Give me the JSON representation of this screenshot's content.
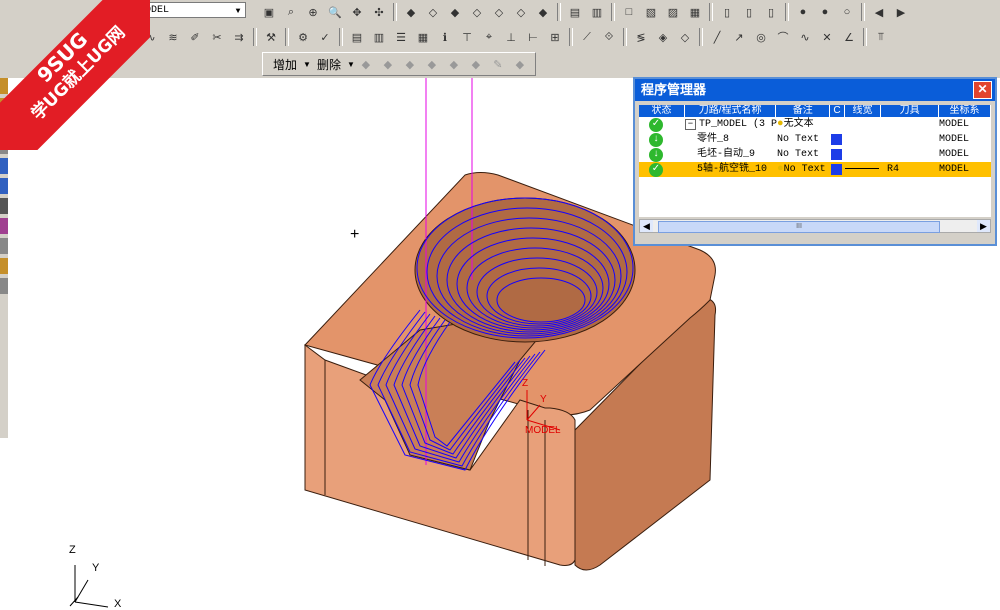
{
  "watermark": {
    "line1": "9SUG",
    "line2": "学UG就上UG网"
  },
  "toolbar": {
    "model_combo": {
      "value": "MODEL"
    },
    "add_label": "增加",
    "delete_label": "删除"
  },
  "navigator": {
    "title": "程序管理器",
    "close_label": "✕",
    "columns": [
      "状态",
      "刀路/程式名称",
      "备注",
      "C",
      "线宽",
      "刀具",
      "坐标系"
    ],
    "rows": [
      {
        "name": "TP_MODEL (3 P",
        "note": "无文本",
        "tool": "",
        "coord": "MODEL"
      },
      {
        "name": "零件_8",
        "note": "No Text",
        "tool": "",
        "coord": "MODEL"
      },
      {
        "name": "毛坯-自动_9",
        "note": "No Text",
        "tool": "",
        "coord": "MODEL"
      },
      {
        "name": "5轴-航空铣_10",
        "note": "No Text",
        "tool": "R4",
        "coord": "MODEL"
      }
    ],
    "scroll_grip": "III"
  },
  "viewport": {
    "model_csys_labels": {
      "z": "Z",
      "y": "Y",
      "name": "MODEL"
    },
    "triad_labels": {
      "z": "Z",
      "y": "Y",
      "x": "X"
    },
    "colors": {
      "part": "#d98e63",
      "toolpath": "#1400ff",
      "axis": "#e600e6",
      "csys": "#e00000"
    }
  }
}
